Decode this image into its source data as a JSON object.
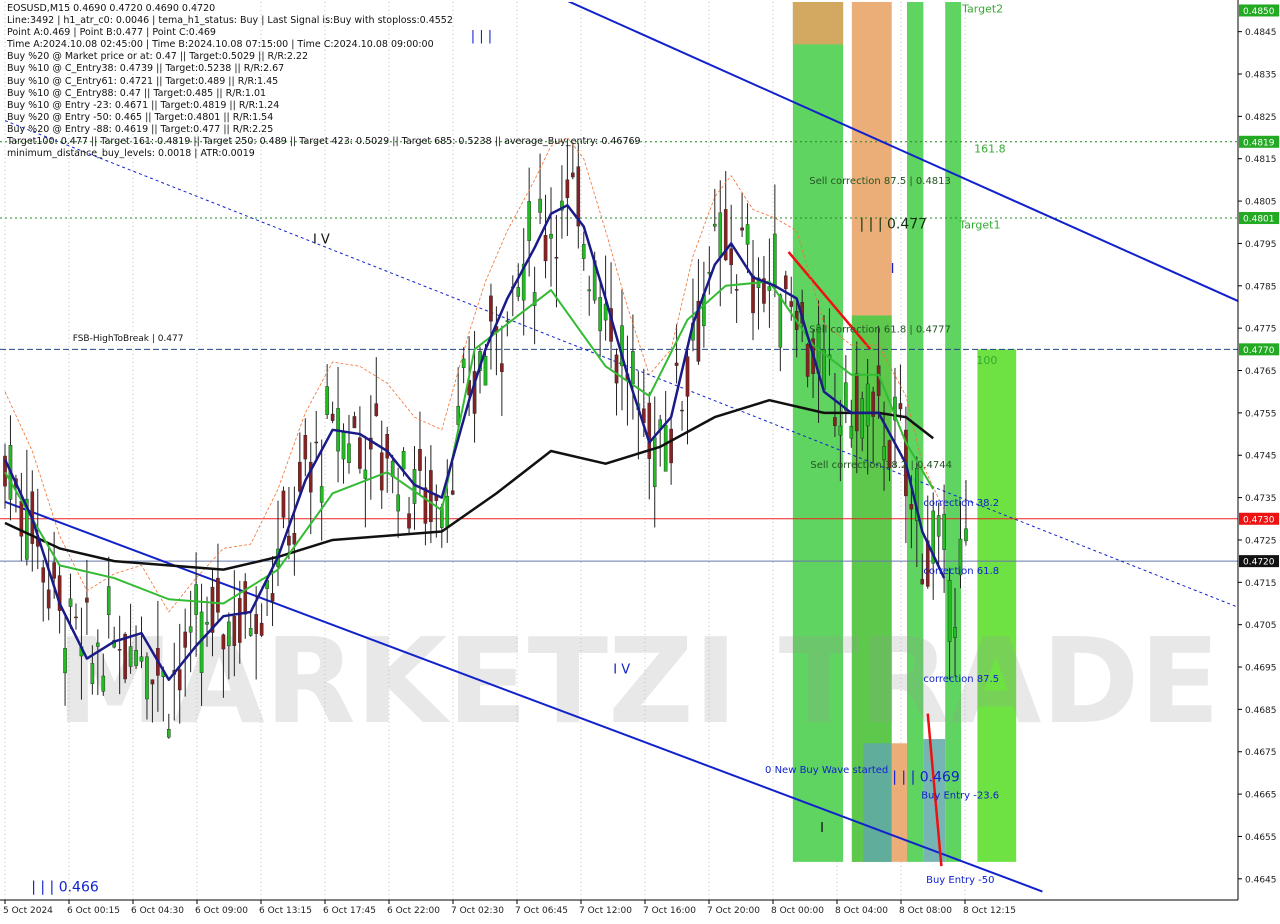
{
  "chart_data": {
    "type": "candlestick",
    "symbol": "EOSUSD,M15",
    "ohlc_header": "EOSUSD,M15  0.4690 0.4720 0.4690 0.4720",
    "info_lines": [
      "Line:3492 | h1_atr_c0: 0.0046 | tema_h1_status: Buy | Last Signal is:Buy with stoploss:0.4552",
      "Point A:0.469 | Point B:0.477 | Point C:0.469",
      "Time A:2024.10.08 02:45:00 | Time B:2024.10.08 07:15:00 | Time C:2024.10.08 09:00:00",
      "Buy %20 @ Market price or at: 0.47 || Target:0.5029 || R/R:2.22",
      "Buy %10 @ C_Entry38: 0.4739 || Target:0.5238 || R/R:2.67",
      "Buy %10 @ C_Entry61: 0.4721 || Target:0.489 || R/R:1.45",
      "Buy %10 @ C_Entry88: 0.47 || Target:0.485 || R/R:1.01",
      "Buy %10 @ Entry -23: 0.4671 || Target:0.4819 || R/R:1.24",
      "Buy %20 @ Entry -50: 0.465 || Target:0.4801 || R/R:1.54",
      "Buy %20 @ Entry -88: 0.4619 || Target:0.477 || R/R:2.25",
      "Target100: 0.477 || Target 161: 0.4819 || Target 250: 0.489 || Target 423: 0.5029 || Target 685: 0.5238 || average_Buy_entry: 0.46769",
      "minimum_distance_buy_levels: 0.0018 | ATR:0.0019"
    ],
    "y_range": [
      0.464,
      0.4852
    ],
    "y_ticks": [
      "0.4845",
      "0.4835",
      "0.4825",
      "0.4815",
      "0.4805",
      "0.4795",
      "0.4785",
      "0.4775",
      "0.4765",
      "0.4755",
      "0.4745",
      "0.4735",
      "0.4725",
      "0.4715",
      "0.4705",
      "0.4695",
      "0.4685",
      "0.4675",
      "0.4665",
      "0.4655",
      "0.4645"
    ],
    "x_ticks": [
      "5 Oct 2024",
      "6 Oct 00:15",
      "6 Oct 04:30",
      "6 Oct 09:00",
      "6 Oct 13:15",
      "6 Oct 17:45",
      "6 Oct 22:00",
      "7 Oct 02:30",
      "7 Oct 06:45",
      "7 Oct 12:00",
      "7 Oct 16:00",
      "7 Oct 20:00",
      "8 Oct 00:00",
      "8 Oct 04:00",
      "8 Oct 08:00",
      "8 Oct 12:15"
    ],
    "price_badges": [
      {
        "value": 0.485,
        "label": "0.4850",
        "color": "#22aa22"
      },
      {
        "value": 0.4819,
        "label": "0.4819",
        "color": "#22aa22"
      },
      {
        "value": 0.4801,
        "label": "0.4801",
        "color": "#22aa22"
      },
      {
        "value": 0.477,
        "label": "0.4770",
        "color": "#22aa22"
      },
      {
        "value": 0.473,
        "label": "0.4730",
        "color": "#ee1111"
      },
      {
        "value": 0.472,
        "label": "0.4720",
        "color": "#111111"
      }
    ],
    "hlines": [
      {
        "value": 0.4819,
        "color": "#228822",
        "dash": "2,3"
      },
      {
        "value": 0.4801,
        "color": "#228822",
        "dash": "2,3"
      },
      {
        "value": 0.477,
        "color": "#224488",
        "dash": "6,3"
      },
      {
        "value": 0.473,
        "color": "#ee2222",
        "dash": ""
      },
      {
        "value": 0.472,
        "color": "#6677aa",
        "dash": ""
      }
    ],
    "zones": [
      {
        "x0": 0.4847,
        "x1": 0.4851,
        "color": "#e8a060"
      },
      {
        "x0": 0.4842,
        "x1": 0.4852,
        "color": "#44cc44"
      }
    ],
    "annotations": [
      {
        "text": "Target2",
        "t": 175.3,
        "v": 0.48495,
        "color": "#33aa33",
        "size": 11
      },
      {
        "text": "161.8",
        "t": 177.5,
        "v": 0.48165,
        "color": "#33aa33",
        "size": 11
      },
      {
        "text": "Target1",
        "t": 174.8,
        "v": 0.47985,
        "color": "#33aa33",
        "size": 11
      },
      {
        "text": "100",
        "t": 177.9,
        "v": 0.47665,
        "color": "#33aa33",
        "size": 11
      },
      {
        "text": "Sell correction 87.5 | 0.4813",
        "t": 147.3,
        "v": 0.4809,
        "color": "#225522",
        "size": 10
      },
      {
        "text": "| | | 0.477",
        "t": 156.5,
        "v": 0.47985,
        "color": "#113311",
        "size": 14
      },
      {
        "text": "Sell correction 61.8 | 0.4777",
        "t": 147.3,
        "v": 0.4774,
        "color": "#225522",
        "size": 10
      },
      {
        "text": "Sell correction 38.2 | 0.4744",
        "t": 147.5,
        "v": 0.4742,
        "color": "#225522",
        "size": 10
      },
      {
        "text": "correction 38.2",
        "t": 168.2,
        "v": 0.4733,
        "color": "#1122cc",
        "size": 10
      },
      {
        "text": "correction 61.8",
        "t": 168.2,
        "v": 0.4717,
        "color": "#1122cc",
        "size": 10
      },
      {
        "text": "correction 87.5",
        "t": 168.2,
        "v": 0.46915,
        "color": "#1122cc",
        "size": 10
      },
      {
        "text": "0 New Buy Wave started",
        "t": 139.2,
        "v": 0.467,
        "color": "#1122cc",
        "size": 10
      },
      {
        "text": "| | | 0.469",
        "t": 162.5,
        "v": 0.4668,
        "color": "#1122cc",
        "size": 14
      },
      {
        "text": "Buy Entry -23.6",
        "t": 167.8,
        "v": 0.4664,
        "color": "#1122cc",
        "size": 10
      },
      {
        "text": "Buy Entry -50",
        "t": 168.7,
        "v": 0.4644,
        "color": "#1122cc",
        "size": 10
      },
      {
        "text": "FSB-HighToBreak | 0.477",
        "t": 12.4,
        "v": 0.4772,
        "color": "#111111",
        "size": 9
      },
      {
        "text": "| | |",
        "t": 85.3,
        "v": 0.4843,
        "color": "#1122cc",
        "size": 13
      },
      {
        "text": "I V",
        "t": 56.4,
        "v": 0.4795,
        "color": "#111111",
        "size": 13
      },
      {
        "text": "I V",
        "t": 111.4,
        "v": 0.46935,
        "color": "#1122cc",
        "size": 13
      },
      {
        "text": "I",
        "t": 162.2,
        "v": 0.4788,
        "color": "#1122cc",
        "size": 13
      },
      {
        "text": "I",
        "t": 149.3,
        "v": 0.4656,
        "color": "#111111",
        "size": 13
      },
      {
        "text": "| | | 0.466",
        "t": 4.8,
        "v": 0.4642,
        "color": "#1122cc",
        "size": 14
      }
    ],
    "trendlines": [
      {
        "t0": 100.0,
        "v0": 0.4854,
        "t1": 230.0,
        "v1": 0.4779,
        "color": "#1122cc",
        "width": 2,
        "dash": ""
      },
      {
        "t0": 0.0,
        "v0": 0.4734,
        "t1": 190.0,
        "v1": 0.4642,
        "color": "#1122cc",
        "width": 2,
        "dash": ""
      },
      {
        "t0": 0.0,
        "v0": 0.4824,
        "t1": 230.0,
        "v1": 0.4707,
        "color": "#1122cc",
        "width": 1,
        "dash": "3,3"
      },
      {
        "t0": 143.5,
        "v0": 0.4793,
        "t1": 158.5,
        "v1": 0.477,
        "color": "#ee1111",
        "width": 2.5,
        "dash": ""
      },
      {
        "t0": 169.0,
        "v0": 0.4684,
        "t1": 171.5,
        "v1": 0.4648,
        "color": "#ee1111",
        "width": 2.5,
        "dash": ""
      }
    ],
    "columns": [
      {
        "t0": 144.3,
        "t1": 153.5,
        "v0": 0.4649,
        "v1": 0.4852,
        "color": "#44cc44"
      },
      {
        "t0": 144.3,
        "t1": 153.5,
        "v0": 0.4842,
        "v1": 0.4852,
        "color": "#e8a060"
      },
      {
        "t0": 155.1,
        "t1": 162.4,
        "v0": 0.4649,
        "v1": 0.4852,
        "color": "#e8a060"
      },
      {
        "t0": 155.1,
        "t1": 162.4,
        "v0": 0.4649,
        "v1": 0.4778,
        "color": "#44cc44"
      },
      {
        "t0": 157.2,
        "t1": 162.4,
        "v0": 0.4649,
        "v1": 0.4677,
        "color": "#5fa8a8"
      },
      {
        "t0": 165.2,
        "t1": 168.2,
        "v0": 0.4649,
        "v1": 0.4852,
        "color": "#44cc44"
      },
      {
        "t0": 162.4,
        "t1": 165.2,
        "v0": 0.4649,
        "v1": 0.4677,
        "color": "#e8a060"
      },
      {
        "t0": 168.2,
        "t1": 172.2,
        "v0": 0.4649,
        "v1": 0.4678,
        "color": "#5fa8a8"
      },
      {
        "t0": 172.2,
        "t1": 175.1,
        "v0": 0.4649,
        "v1": 0.4852,
        "color": "#44cc44"
      },
      {
        "t0": 178.1,
        "t1": 185.2,
        "v0": 0.4649,
        "v1": 0.477,
        "color": "#55dd22"
      }
    ],
    "series": [
      {
        "name": "",
        "color": "#111111",
        "width": 2.5,
        "points": [
          [
            0,
            0.4729
          ],
          [
            10,
            0.4723
          ],
          [
            20,
            0.472
          ],
          [
            30,
            0.4719
          ],
          [
            40,
            0.4718
          ],
          [
            50,
            0.4721
          ],
          [
            60,
            0.4725
          ],
          [
            70,
            0.4726
          ],
          [
            80,
            0.4727
          ],
          [
            90,
            0.4736
          ],
          [
            100,
            0.4746
          ],
          [
            110,
            0.4743
          ],
          [
            120,
            0.4747
          ],
          [
            130,
            0.4754
          ],
          [
            140,
            0.4758
          ],
          [
            150,
            0.4755
          ],
          [
            160,
            0.4755
          ],
          [
            165,
            0.4754
          ],
          [
            170,
            0.4749
          ]
        ]
      },
      {
        "name": "",
        "color": "#33bb33",
        "width": 2,
        "points": [
          [
            0,
            0.4741
          ],
          [
            10,
            0.4719
          ],
          [
            20,
            0.4716
          ],
          [
            30,
            0.4711
          ],
          [
            40,
            0.471
          ],
          [
            50,
            0.4718
          ],
          [
            60,
            0.4736
          ],
          [
            70,
            0.4741
          ],
          [
            80,
            0.4732
          ],
          [
            86,
            0.477
          ],
          [
            100,
            0.4784
          ],
          [
            110,
            0.4766
          ],
          [
            118,
            0.4759
          ],
          [
            125,
            0.4777
          ],
          [
            132,
            0.4785
          ],
          [
            140,
            0.4786
          ],
          [
            148,
            0.4771
          ],
          [
            155,
            0.4764
          ],
          [
            160,
            0.4764
          ],
          [
            165,
            0.4748
          ],
          [
            170,
            0.4737
          ]
        ]
      },
      {
        "name": "",
        "color": "#1a1a88",
        "width": 2.5,
        "points": [
          [
            0,
            0.4744
          ],
          [
            5,
            0.473
          ],
          [
            10,
            0.471
          ],
          [
            15,
            0.4697
          ],
          [
            20,
            0.4701
          ],
          [
            25,
            0.4703
          ],
          [
            30,
            0.4692
          ],
          [
            35,
            0.47
          ],
          [
            40,
            0.4707
          ],
          [
            45,
            0.4708
          ],
          [
            50,
            0.4721
          ],
          [
            55,
            0.4739
          ],
          [
            60,
            0.4751
          ],
          [
            65,
            0.475
          ],
          [
            70,
            0.4746
          ],
          [
            75,
            0.4738
          ],
          [
            80,
            0.4735
          ],
          [
            85,
            0.4758
          ],
          [
            88,
            0.477
          ],
          [
            92,
            0.4782
          ],
          [
            97,
            0.4794
          ],
          [
            100,
            0.4802
          ],
          [
            103,
            0.4804
          ],
          [
            106,
            0.4799
          ],
          [
            110,
            0.4782
          ],
          [
            114,
            0.4764
          ],
          [
            118,
            0.4748
          ],
          [
            122,
            0.4754
          ],
          [
            126,
            0.4776
          ],
          [
            130,
            0.479
          ],
          [
            133,
            0.4795
          ],
          [
            137,
            0.4787
          ],
          [
            141,
            0.4785
          ],
          [
            145,
            0.4782
          ],
          [
            150,
            0.476
          ],
          [
            155,
            0.4755
          ],
          [
            160,
            0.4755
          ],
          [
            165,
            0.4743
          ],
          [
            168,
            0.4727
          ],
          [
            172,
            0.4716
          ]
        ]
      }
    ]
  },
  "watermark": "MARKETZI TRADE"
}
